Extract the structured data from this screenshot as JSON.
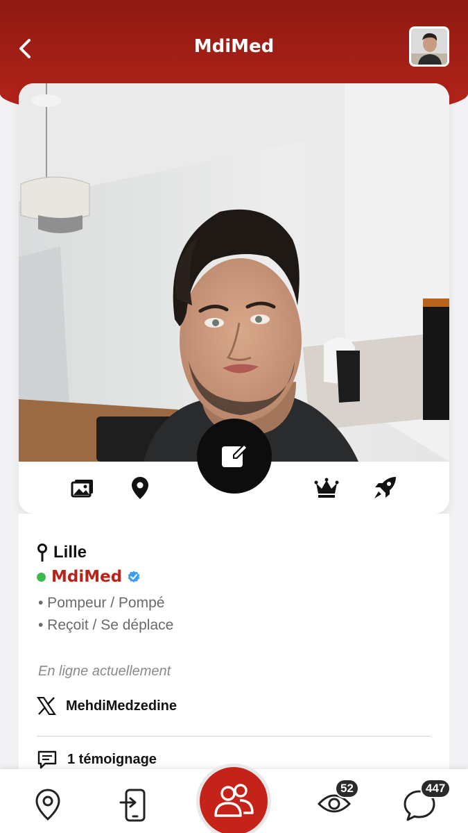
{
  "header": {
    "title": "MdiMed"
  },
  "profile": {
    "city": "Lille",
    "username": "MdiMed",
    "verified": true,
    "online": true,
    "tags": [
      "• Pompeur / Pompé",
      "• Reçoit / Se déplace"
    ],
    "status": "En ligne actuellement",
    "social_handle": "MehdiMedzedine",
    "testimonials": "1 témoignage"
  },
  "action_bar": {
    "icons": [
      "gallery-icon",
      "location-pin-icon",
      "edit-icon",
      "crown-icon",
      "rocket-icon"
    ]
  },
  "tabbar": {
    "items": [
      {
        "icon": "map-pin-icon"
      },
      {
        "icon": "phone-login-icon"
      },
      {
        "icon": "users-icon"
      },
      {
        "icon": "eye-icon",
        "badge": "52"
      },
      {
        "icon": "chat-bubble-icon",
        "badge": "447"
      }
    ]
  },
  "colors": {
    "brand_red": "#b8241a",
    "online_green": "#3dbb4b",
    "verified_blue": "#3b9cf0"
  }
}
